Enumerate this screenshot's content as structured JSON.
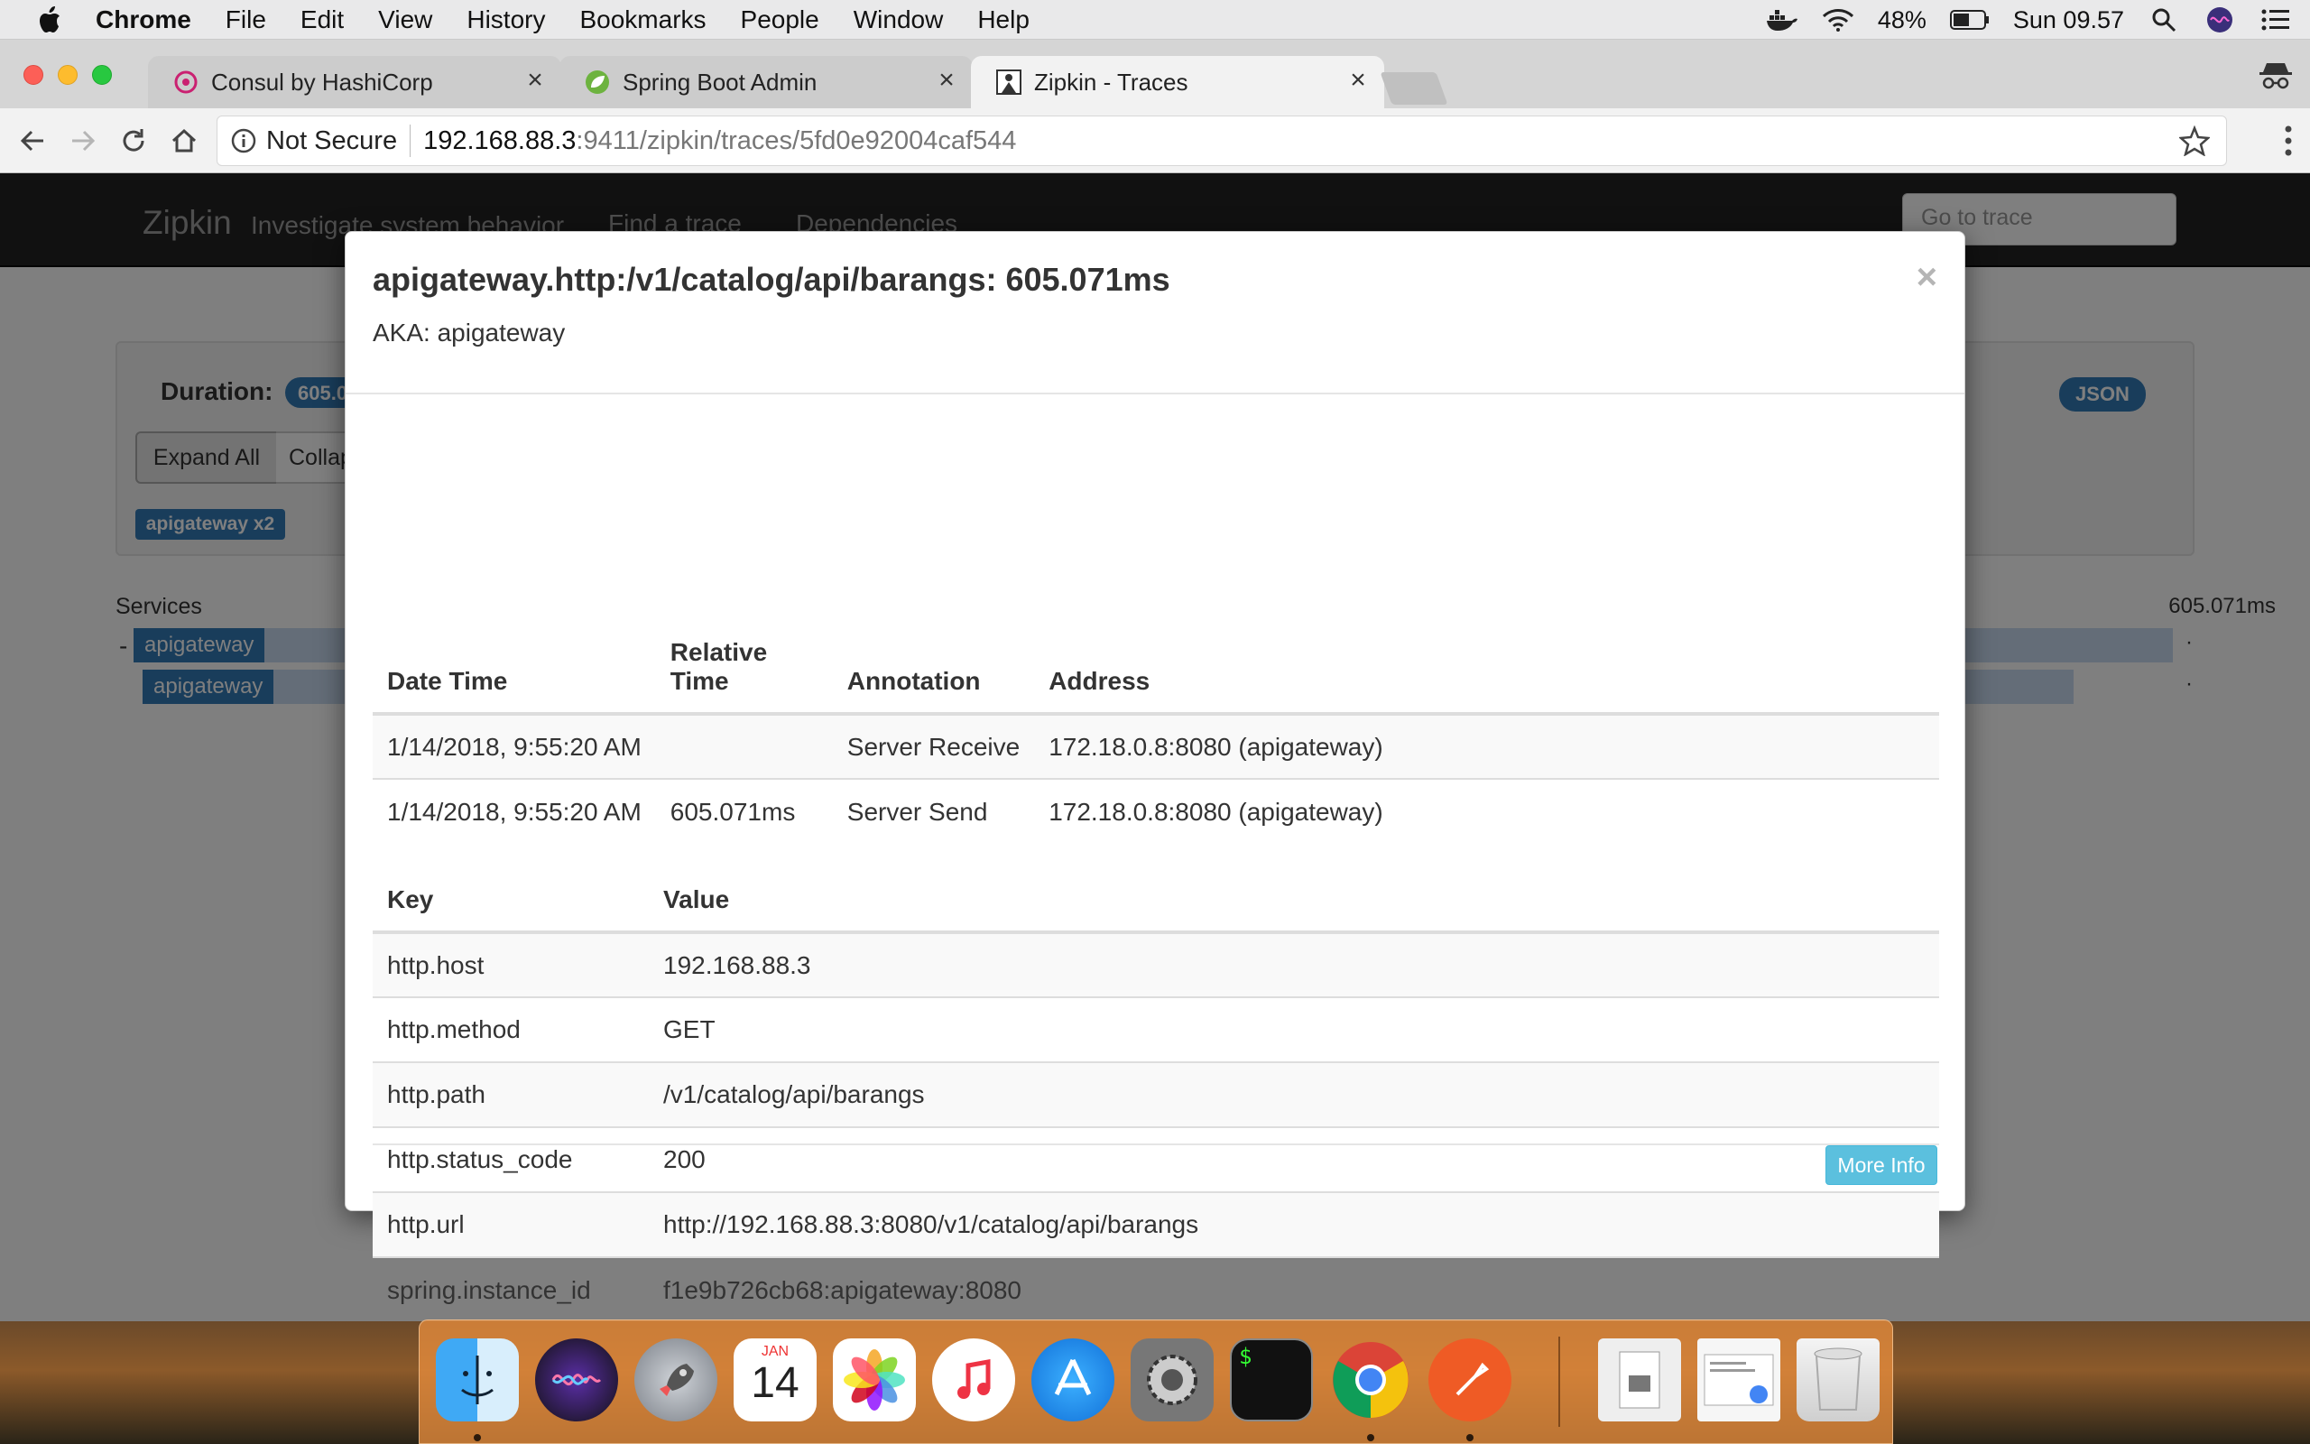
{
  "menubar": {
    "app_name": "Chrome",
    "items": [
      "File",
      "Edit",
      "View",
      "History",
      "Bookmarks",
      "People",
      "Window",
      "Help"
    ],
    "battery": "48%",
    "clock": "Sun 09.57"
  },
  "browser": {
    "tabs": [
      {
        "title": "Consul by HashiCorp",
        "icon": "consul-icon"
      },
      {
        "title": "Spring Boot Admin",
        "icon": "spring-leaf-icon"
      },
      {
        "title": "Zipkin - Traces",
        "icon": "zipkin-icon",
        "active": true
      }
    ],
    "security_label": "Not Secure",
    "url_host": "192.168.88.3",
    "url_path": ":9411/zipkin/traces/5fd0e92004caf544"
  },
  "zipkin": {
    "brand": "Zipkin",
    "tagline": "Investigate system behavior",
    "nav": [
      "Find a trace",
      "Dependencies"
    ],
    "goto_placeholder": "Go to trace",
    "duration_label": "Duration:",
    "duration_value": "605.071ms",
    "expand_all": "Expand All",
    "collapse_all": "Collapse All",
    "service_badge": "apigateway x2",
    "json_button": "JSON",
    "services_label": "Services",
    "total_duration": "605.071ms",
    "spans": [
      {
        "service": "apigateway",
        "toggle": "-",
        "bar_fraction": 1.0
      },
      {
        "service": "apigateway",
        "toggle": "",
        "bar_fraction": 0.95
      }
    ]
  },
  "modal": {
    "title": "apigateway.http:/v1/catalog/api/barangs: 605.071ms",
    "aka_label": "AKA:",
    "aka_value": "apigateway",
    "close": "×",
    "annotations_headers": [
      "Date Time",
      "Relative Time",
      "Annotation",
      "Address"
    ],
    "annotations": [
      {
        "date_time": "1/14/2018, 9:55:20 AM",
        "relative_time": "",
        "annotation": "Server Receive",
        "address": "172.18.0.8:8080 (apigateway)"
      },
      {
        "date_time": "1/14/2018, 9:55:20 AM",
        "relative_time": "605.071ms",
        "annotation": "Server Send",
        "address": "172.18.0.8:8080 (apigateway)"
      }
    ],
    "kv_headers": [
      "Key",
      "Value"
    ],
    "tags": [
      {
        "key": "http.host",
        "value": "192.168.88.3"
      },
      {
        "key": "http.method",
        "value": "GET"
      },
      {
        "key": "http.path",
        "value": "/v1/catalog/api/barangs"
      },
      {
        "key": "http.status_code",
        "value": "200"
      },
      {
        "key": "http.url",
        "value": "http://192.168.88.3:8080/v1/catalog/api/barangs"
      },
      {
        "key": "spring.instance_id",
        "value": "f1e9b726cb68:apigateway:8080"
      }
    ],
    "more_info": "More Info"
  },
  "dock": {
    "calendar_month": "JAN",
    "calendar_day": "14",
    "apps": [
      "finder-icon",
      "siri-icon",
      "launchpad-icon",
      "calendar-icon",
      "photos-icon",
      "itunes-icon",
      "app-store-icon",
      "system-preferences-icon",
      "terminal-icon",
      "chrome-icon",
      "postman-icon",
      "file-icon",
      "screenshot-icon",
      "trash-icon"
    ]
  },
  "colors": {
    "zipkin_primary": "#337ab7",
    "info_button": "#5bc0de",
    "navbar": "#222222"
  }
}
